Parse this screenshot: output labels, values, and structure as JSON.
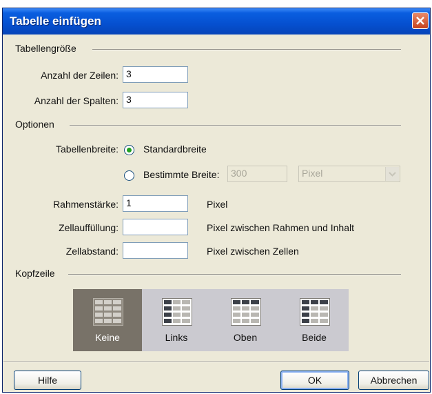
{
  "window": {
    "title": "Tabelle einfügen"
  },
  "sections": {
    "size": "Tabellengröße",
    "options": "Optionen",
    "header": "Kopfzeile"
  },
  "size": {
    "rows_label": "Anzahl der Zeilen:",
    "rows_value": "3",
    "cols_label": "Anzahl der Spalten:",
    "cols_value": "3"
  },
  "options": {
    "width_label": "Tabellenbreite:",
    "standard_label": "Standardbreite",
    "custom_label": "Bestimmte Breite:",
    "custom_value": "300",
    "unit_value": "Pixel",
    "border_label": "Rahmenstärke:",
    "border_value": "1",
    "border_unit": "Pixel",
    "padding_label": "Zellauffüllung:",
    "padding_value": "",
    "padding_unit": "Pixel zwischen Rahmen und Inhalt",
    "spacing_label": "Zellabstand:",
    "spacing_value": "",
    "spacing_unit": "Pixel zwischen Zellen",
    "selected_width": "Standardbreite"
  },
  "header_options": [
    {
      "label": "Keine",
      "selected": true
    },
    {
      "label": "Links",
      "selected": false
    },
    {
      "label": "Oben",
      "selected": false
    },
    {
      "label": "Beide",
      "selected": false
    }
  ],
  "buttons": {
    "help": "Hilfe",
    "ok": "OK",
    "cancel": "Abbrechen"
  },
  "colors": {
    "titlebar": "#0550d0",
    "selected_header": "#787268",
    "panel": "#cbcad0",
    "radio_dot": "#21a121"
  }
}
